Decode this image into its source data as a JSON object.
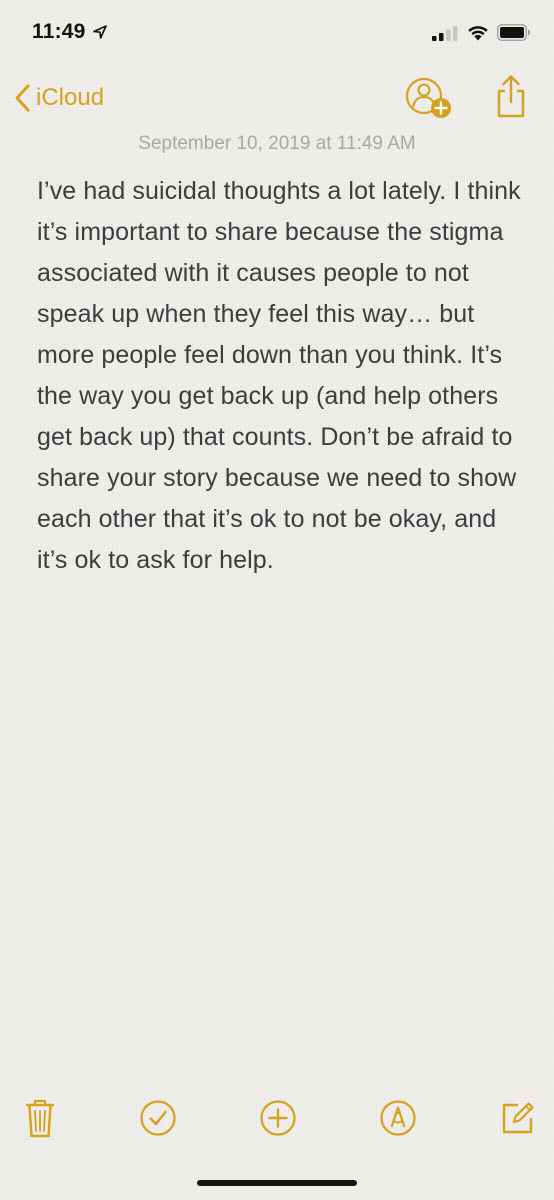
{
  "status_bar": {
    "time": "11:49",
    "icons": [
      "location-arrow-icon",
      "cellular-signal-icon",
      "wifi-icon",
      "battery-icon"
    ]
  },
  "nav": {
    "back_label": "iCloud",
    "icons": [
      "chevron-left-icon",
      "add-people-icon",
      "share-icon"
    ]
  },
  "note": {
    "date": "September 10, 2019 at 11:49 AM",
    "body": "I’ve had suicidal thoughts a lot lately. I think it’s important to share because the stigma associated with it causes people to not speak up when they feel this way… but more people feel down than you think. It’s the way you get back up (and help others get back up) that counts. Don’t be afraid to share your story because we need to show each other that it’s ok to not be okay, and it’s ok to ask for help."
  },
  "toolbar": {
    "icons": [
      "trash-icon",
      "checklist-icon",
      "add-icon",
      "markup-pen-icon",
      "compose-icon"
    ]
  },
  "colors": {
    "accent": "#d6a11b",
    "background": "#efeeeb",
    "text": "#3d3d3d",
    "date_text": "#a9a8a5"
  }
}
